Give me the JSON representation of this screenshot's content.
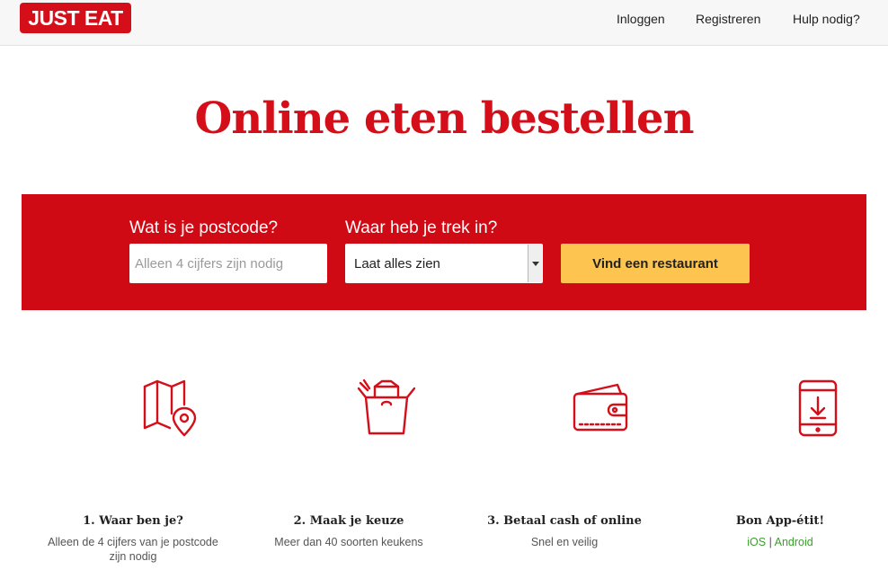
{
  "header": {
    "logo_text": "JUST EAT",
    "nav": {
      "login": "Inloggen",
      "register": "Registreren",
      "help": "Hulp nodig?"
    }
  },
  "hero": {
    "title": "Online eten bestellen"
  },
  "search": {
    "postcode_label": "Wat is je postcode?",
    "postcode_placeholder": "Alleen 4 cijfers zijn nodig",
    "postcode_value": "",
    "cuisine_label": "Waar heb je trek in?",
    "cuisine_selected": "Laat alles zien",
    "submit_label": "Vind een restaurant"
  },
  "steps": [
    {
      "icon": "map-pin-icon",
      "title": "1. Waar ben je?",
      "description": "Alleen de 4 cijfers van je postcode zijn nodig"
    },
    {
      "icon": "takeout-box-icon",
      "title": "2. Maak je keuze",
      "description": "Meer dan 40 soorten keukens"
    },
    {
      "icon": "wallet-icon",
      "title": "3. Betaal cash of online",
      "description": "Snel en veilig"
    },
    {
      "icon": "phone-download-icon",
      "title": "Bon App-étit!",
      "apps": {
        "ios": "iOS",
        "separator": "|",
        "android": "Android"
      }
    }
  ],
  "colors": {
    "brand_red": "#d50f19",
    "band_red": "#cf0a14",
    "button_yellow": "#fdc450",
    "link_green": "#3d9d2f"
  }
}
